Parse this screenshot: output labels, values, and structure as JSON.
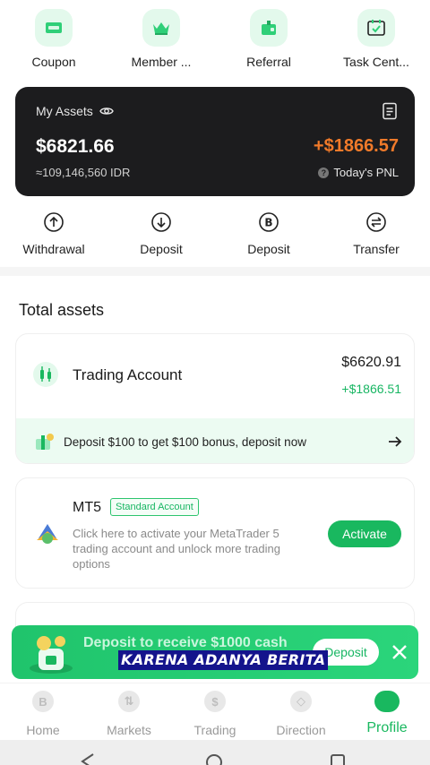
{
  "shortcuts": [
    {
      "label": "Coupon",
      "icon": "coupon-icon"
    },
    {
      "label": "Member ...",
      "icon": "crown-icon"
    },
    {
      "label": "Referral",
      "icon": "gift-icon"
    },
    {
      "label": "Task Cent...",
      "icon": "calendar-check-icon"
    }
  ],
  "assets": {
    "title": "My Assets",
    "balance": "$6821.66",
    "balance_idr": "≈109,146,560 IDR",
    "pnl": "+$1866.57",
    "pnl_label": "Today's PNL"
  },
  "actions": [
    {
      "label": "Withdrawal",
      "icon": "upload-icon"
    },
    {
      "label": "Deposit",
      "icon": "download-icon"
    },
    {
      "label": "Deposit",
      "icon": "bitcoin-icon"
    },
    {
      "label": "Transfer",
      "icon": "transfer-icon"
    }
  ],
  "total_assets": {
    "title": "Total assets",
    "trading_account": {
      "name": "Trading Account",
      "balance": "$6620.91",
      "pnl": "+$1866.51",
      "promo": "Deposit $100 to get $100 bonus, deposit now"
    },
    "mt5": {
      "title": "MT5",
      "badge": "Standard Account",
      "description": "Click here to activate your MetaTrader 5 trading account and unlock more trading options",
      "button": "Activate"
    }
  },
  "banner": {
    "text": "Deposit to receive $1000 cash",
    "button": "Deposit"
  },
  "caption": "KARENA ADANYA BERITA",
  "nav": [
    {
      "label": "Home",
      "glyph": "B",
      "active": false
    },
    {
      "label": "Markets",
      "glyph": "⇅",
      "active": false
    },
    {
      "label": "Trading",
      "glyph": "$",
      "active": false
    },
    {
      "label": "Direction",
      "glyph": "◇",
      "active": false
    },
    {
      "label": "Profile",
      "glyph": "●",
      "active": true
    }
  ],
  "colors": {
    "accent": "#19b85f",
    "pnl_orange": "#f07a2a",
    "card_dark": "#1c1c1e"
  }
}
